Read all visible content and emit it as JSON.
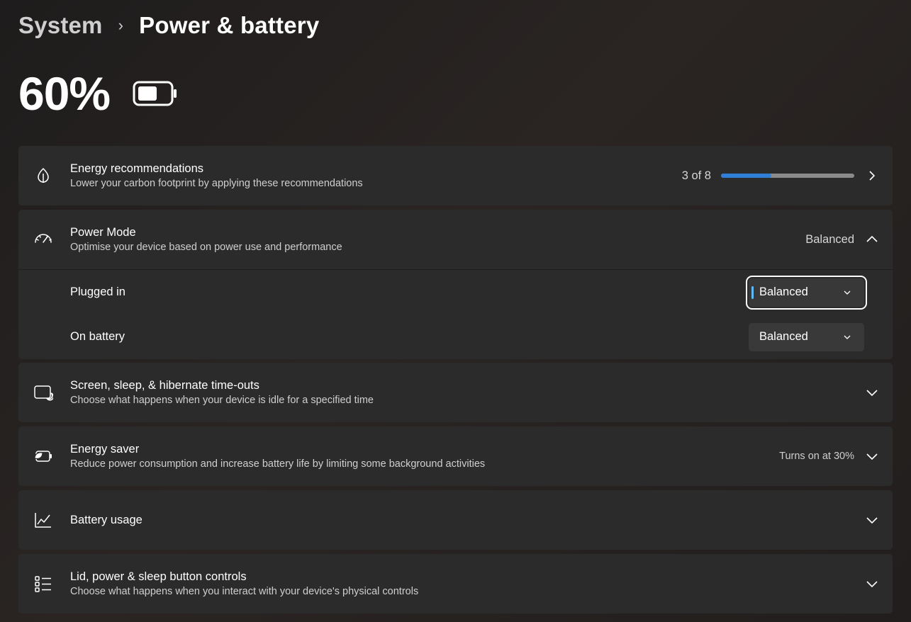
{
  "breadcrumb": {
    "parent": "System",
    "separator": "›",
    "current": "Power & battery"
  },
  "battery": {
    "percent_label": "60%",
    "level": 0.6
  },
  "energy_recommendations": {
    "title": "Energy recommendations",
    "subtitle": "Lower your carbon footprint by applying these recommendations",
    "progress_label": "3 of 8",
    "progress": {
      "done": 3,
      "total": 8
    },
    "icon": "leaf-icon"
  },
  "power_mode": {
    "title": "Power Mode",
    "subtitle": "Optimise your device based on power use and performance",
    "value": "Balanced",
    "icon": "gauge-icon",
    "plugged_in": {
      "label": "Plugged in",
      "value": "Balanced"
    },
    "on_battery": {
      "label": "On battery",
      "value": "Balanced"
    }
  },
  "screen_sleep": {
    "title": "Screen, sleep, & hibernate time-outs",
    "subtitle": "Choose what happens when your device is idle for a specified time",
    "icon": "screen-sleep-icon"
  },
  "energy_saver": {
    "title": "Energy saver",
    "subtitle": "Reduce power consumption and increase battery life by limiting some background activities",
    "status": "Turns on at 30%",
    "icon": "battery-saver-icon"
  },
  "battery_usage": {
    "title": "Battery usage",
    "icon": "line-chart-icon"
  },
  "lid_controls": {
    "title": "Lid, power & sleep button controls",
    "subtitle": "Choose what happens when you interact with your device's physical controls",
    "icon": "list-icon"
  },
  "colors": {
    "accent": "#2f7fd6",
    "card": "#2c2b2b",
    "focus_accent": "#60b8f5"
  }
}
